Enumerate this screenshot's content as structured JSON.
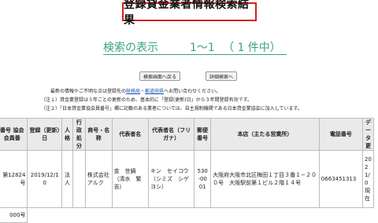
{
  "page_title": "登録貸金業者情報検索結果",
  "results": {
    "label": "検索の表示",
    "range": "1～1",
    "count": "（ 1 件中）"
  },
  "buttons": {
    "back": "検索画面へ戻る",
    "detail": "詳細検索へ"
  },
  "notes": {
    "line1_prefix": "最新の情報やご不明な点は登録先の",
    "link1": "財務局",
    "sep": "・",
    "link2": "都道府県",
    "line1_suffix": "へお問い合わせください。",
    "line2": "（注１）貸金業登録は３年ごとの更新のため、基本的に「登録(更新)日」から３年間登録有効です。",
    "line3": "（注２）「日本貸金業協会員番号」欄に記載のある業者については、自主規制機関である日本貸金業協会に加入しています。"
  },
  "table": {
    "headers": [
      "番号 協会会員番",
      "登録（更新）日",
      "人格",
      "行政処分",
      "商号・名称",
      "代表者名",
      "代表者名（フリガナ）",
      "郵便番号",
      "本店（主たる営業所）",
      "電話番号",
      "データ更"
    ],
    "row": {
      "number": "第12824号",
      "date": "2019/12/10",
      "type": "法人",
      "admin": "",
      "name": "株式会社アルク",
      "rep": "金　世鍋（清水　繁吉）",
      "rep_kana": "キン　セイコウ（シミズ　シゲヨシ）",
      "postal": "530-0001",
      "address": "大阪府大阪市北区梅田１丁目３番１−２００号　大阪駅前第１ビル２階１４号",
      "phone": "0663451313",
      "updated": "2021/0 現在"
    },
    "extra": "000号"
  }
}
